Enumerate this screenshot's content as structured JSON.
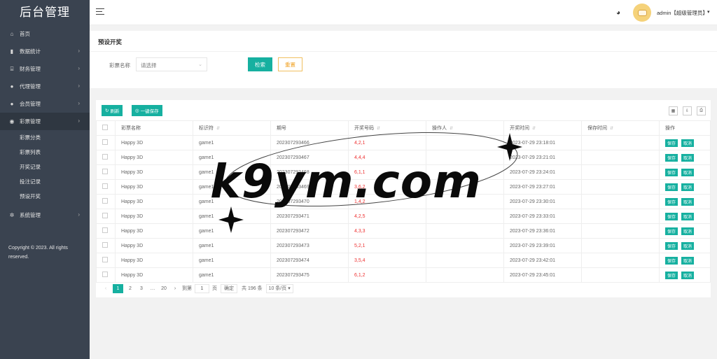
{
  "sidebar": {
    "brand": "后台管理",
    "menu": [
      {
        "label": "首页",
        "icon": "home-icon",
        "glyph": "⌂"
      },
      {
        "label": "数据统计",
        "icon": "bar-chart-icon",
        "glyph": "▮"
      },
      {
        "label": "财务管理",
        "icon": "bank-icon",
        "glyph": "⌸"
      },
      {
        "label": "代理管理",
        "icon": "user-icon",
        "glyph": "●"
      },
      {
        "label": "会员管理",
        "icon": "users-icon",
        "glyph": "●"
      },
      {
        "label": "彩票管理",
        "icon": "gamepad-icon",
        "glyph": "◉"
      }
    ],
    "submenu": [
      "彩票分类",
      "彩票列表",
      "开奖记录",
      "投注记录",
      "预设开奖"
    ],
    "system": {
      "label": "系统管理",
      "icon": "gear-icon",
      "glyph": "✲"
    },
    "copyright": "Copyright © 2023. All rights reserved."
  },
  "header": {
    "user": "admin【超级管理员】"
  },
  "search": {
    "title": "预设开奖",
    "lottery_label": "彩票名称",
    "select_placeholder": "请选择",
    "search_label": "检索",
    "reset_label": "重置"
  },
  "toolbar": {
    "refresh_label": "刷新",
    "save_all_label": "一键保存"
  },
  "table": {
    "columns": [
      "彩票名称",
      "标识符",
      "期号",
      "开奖号码",
      "操作人",
      "开奖时间",
      "保存时间",
      "操作"
    ],
    "rows": [
      {
        "name": "Happy 3D",
        "code": "game1",
        "issue": "202307293466",
        "numbers": "4,2,1",
        "operator": "",
        "draw_time": "2023-07-29 23:18:01",
        "save_time": ""
      },
      {
        "name": "Happy 3D",
        "code": "game1",
        "issue": "202307293467",
        "numbers": "4,4,4",
        "operator": "",
        "draw_time": "2023-07-29 23:21:01",
        "save_time": ""
      },
      {
        "name": "Happy 3D",
        "code": "game1",
        "issue": "202307293468",
        "numbers": "6,1,1",
        "operator": "",
        "draw_time": "2023-07-29 23:24:01",
        "save_time": ""
      },
      {
        "name": "Happy 3D",
        "code": "game1",
        "issue": "202307293469",
        "numbers": "3,6,2",
        "operator": "",
        "draw_time": "2023-07-29 23:27:01",
        "save_time": ""
      },
      {
        "name": "Happy 3D",
        "code": "game1",
        "issue": "202307293470",
        "numbers": "1,4,2",
        "operator": "",
        "draw_time": "2023-07-29 23:30:01",
        "save_time": ""
      },
      {
        "name": "Happy 3D",
        "code": "game1",
        "issue": "202307293471",
        "numbers": "4,2,5",
        "operator": "",
        "draw_time": "2023-07-29 23:33:01",
        "save_time": ""
      },
      {
        "name": "Happy 3D",
        "code": "game1",
        "issue": "202307293472",
        "numbers": "4,3,3",
        "operator": "",
        "draw_time": "2023-07-29 23:36:01",
        "save_time": ""
      },
      {
        "name": "Happy 3D",
        "code": "game1",
        "issue": "202307293473",
        "numbers": "5,2,1",
        "operator": "",
        "draw_time": "2023-07-29 23:39:01",
        "save_time": ""
      },
      {
        "name": "Happy 3D",
        "code": "game1",
        "issue": "202307293474",
        "numbers": "3,5,4",
        "operator": "",
        "draw_time": "2023-07-29 23:42:01",
        "save_time": ""
      },
      {
        "name": "Happy 3D",
        "code": "game1",
        "issue": "202307293475",
        "numbers": "6,1,2",
        "operator": "",
        "draw_time": "2023-07-29 23:45:01",
        "save_time": ""
      }
    ],
    "save_btn": "保存",
    "cancel_btn": "取消"
  },
  "pager": {
    "pages": [
      "1",
      "2",
      "3",
      "…",
      "20"
    ],
    "goto_label": "到第",
    "page_input": "1",
    "page_unit": "页",
    "confirm_label": "确定",
    "total": "共 196 条",
    "page_size": "10 条/页"
  },
  "watermark": "k9ym.com",
  "colors": {
    "accent": "#16b0a0",
    "sidebar": "#3a4350",
    "draw_numbers": "#e33333",
    "reset": "#f0a020"
  }
}
